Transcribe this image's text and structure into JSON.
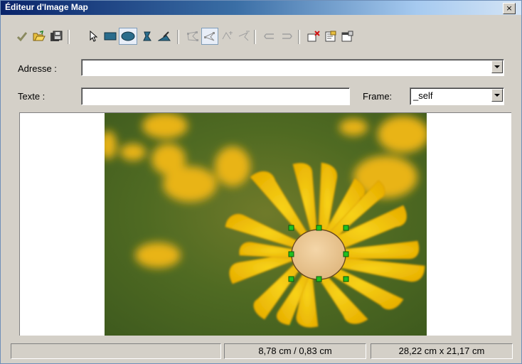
{
  "window": {
    "title": "Éditeur d'Image Map",
    "close_label": "×"
  },
  "toolbar": {
    "buttons": [
      {
        "name": "apply-icon"
      },
      {
        "name": "open-icon"
      },
      {
        "name": "save-icon"
      },
      {
        "name": "select-icon"
      },
      {
        "name": "rectangle-icon"
      },
      {
        "name": "ellipse-icon"
      },
      {
        "name": "polygon-icon"
      },
      {
        "name": "freeform-polygon-icon"
      },
      {
        "name": "edit-points-icon"
      },
      {
        "name": "move-points-icon"
      },
      {
        "name": "insert-points-icon"
      },
      {
        "name": "delete-points-icon"
      },
      {
        "name": "undo-icon"
      },
      {
        "name": "redo-icon"
      },
      {
        "name": "active-icon"
      },
      {
        "name": "macro-icon"
      },
      {
        "name": "properties-icon"
      }
    ]
  },
  "form": {
    "address_label": "Adresse :",
    "address_value": "",
    "text_label": "Texte :",
    "text_value": "",
    "frame_label": "Frame:",
    "frame_value": "_self"
  },
  "status": {
    "left": "",
    "position": "8,78 cm / 0,83 cm",
    "size": "28,22 cm x 21,17 cm"
  }
}
